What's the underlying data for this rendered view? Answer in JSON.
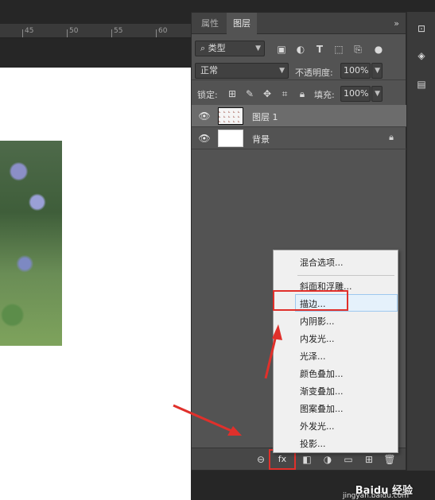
{
  "ruler": {
    "ticks": [
      "45",
      "50",
      "55",
      "60"
    ]
  },
  "panel": {
    "tabs": [
      "属性",
      "图层"
    ],
    "tab_extra": "»",
    "filter_label": "类型",
    "blend_mode": "正常",
    "opacity_label": "不透明度:",
    "opacity_value": "100%",
    "lock_label": "锁定:",
    "fill_label": "填充:",
    "fill_value": "100%",
    "layers": [
      {
        "name": "图层 1",
        "selected": true,
        "locked": false
      },
      {
        "name": "背景",
        "selected": false,
        "locked": true
      }
    ],
    "bottom": {
      "fx_label": "fx"
    }
  },
  "context_menu": {
    "items": [
      "混合选项...",
      "斜面和浮雕...",
      "描边...",
      "内阴影...",
      "内发光...",
      "光泽...",
      "颜色叠加...",
      "渐变叠加...",
      "图案叠加...",
      "外发光...",
      "投影..."
    ],
    "highlighted": "描边..."
  },
  "colors": {
    "highlight_red": "#e0302b",
    "panel_bg": "#535353",
    "menu_bg": "#f0f0f0"
  },
  "watermark": {
    "brand": "Baidu 经验",
    "url": "jingyan.baidu.com"
  }
}
